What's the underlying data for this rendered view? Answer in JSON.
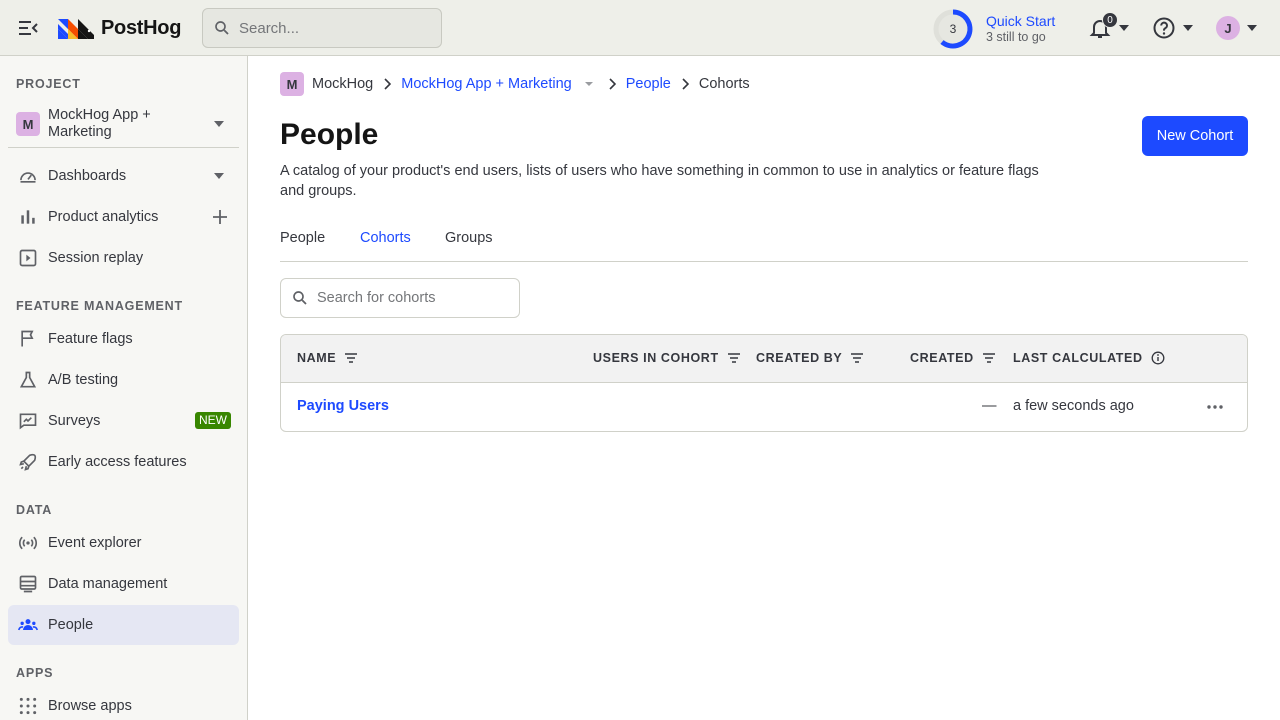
{
  "topbar": {
    "logo_text": "PostHog",
    "search_placeholder": "Search...",
    "quick_start": {
      "count": "3",
      "title": "Quick Start",
      "subtitle": "3 still to go"
    },
    "notifications_count": "0",
    "user_initial": "J"
  },
  "sidebar": {
    "project_section": "PROJECT",
    "project": {
      "badge": "M",
      "name": "MockHog App + Marketing"
    },
    "items_main": [
      {
        "label": "Dashboards",
        "icon": "dashboard-icon"
      },
      {
        "label": "Product analytics",
        "icon": "bar-chart-icon"
      },
      {
        "label": "Session replay",
        "icon": "play-square-icon"
      }
    ],
    "feature_section": "FEATURE MANAGEMENT",
    "items_feature": [
      {
        "label": "Feature flags",
        "icon": "flag-icon"
      },
      {
        "label": "A/B testing",
        "icon": "flask-icon"
      },
      {
        "label": "Surveys",
        "icon": "survey-icon",
        "badge": "NEW"
      },
      {
        "label": "Early access features",
        "icon": "rocket-icon"
      }
    ],
    "data_section": "DATA",
    "items_data": [
      {
        "label": "Event explorer",
        "icon": "broadcast-icon"
      },
      {
        "label": "Data management",
        "icon": "database-icon"
      },
      {
        "label": "People",
        "icon": "people-icon"
      }
    ],
    "apps_section": "APPS",
    "items_apps": [
      {
        "label": "Browse apps",
        "icon": "grid-icon"
      }
    ]
  },
  "breadcrumb": {
    "org_badge": "M",
    "org": "MockHog",
    "project": "MockHog App + Marketing",
    "section": "People",
    "current": "Cohorts"
  },
  "page": {
    "title": "People",
    "description": "A catalog of your product's end users, lists of users who have something in common to use in analytics or feature flags and groups.",
    "new_button": "New Cohort"
  },
  "tabs": [
    {
      "label": "People",
      "active": false
    },
    {
      "label": "Cohorts",
      "active": true
    },
    {
      "label": "Groups",
      "active": false
    }
  ],
  "cohort_search_placeholder": "Search for cohorts",
  "table": {
    "columns": [
      "NAME",
      "USERS IN COHORT",
      "CREATED BY",
      "CREATED",
      "LAST CALCULATED"
    ],
    "rows": [
      {
        "name": "Paying Users",
        "users": "",
        "created_by": "",
        "created": "—",
        "last_calculated": "a few seconds ago"
      }
    ]
  },
  "colors": {
    "accent": "#1d4aff",
    "new_badge": "#388600",
    "active_nav": "#e5e7f3"
  }
}
